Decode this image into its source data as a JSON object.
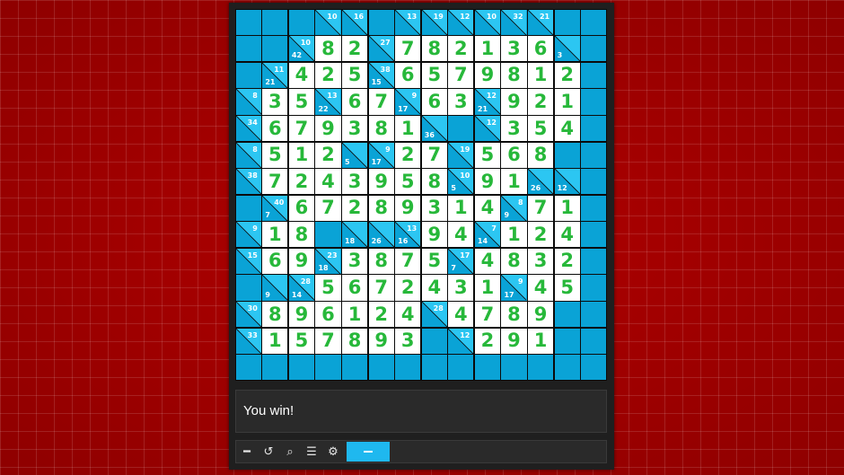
{
  "status": {
    "message": "You win!"
  },
  "toolbar": {
    "buttons": [
      {
        "name": "menu-dash-button",
        "icon": "dash-icon",
        "glyph": "━"
      },
      {
        "name": "restart-button",
        "icon": "restart-icon",
        "glyph": "↺"
      },
      {
        "name": "search-button",
        "icon": "search-icon",
        "glyph": "⌕"
      },
      {
        "name": "list-button",
        "icon": "list-icon",
        "glyph": "☰"
      },
      {
        "name": "settings-button",
        "icon": "gear-icon",
        "glyph": "⚙"
      }
    ],
    "progress": 1.0
  },
  "colors": {
    "block": "#0aa3d6",
    "block_light": "#2cc6f2",
    "digit": "#27b83a",
    "cell_bg": "#ffffff"
  },
  "grid": {
    "size": 14,
    "rows": [
      [
        "#",
        "#",
        "#",
        "c:10",
        "c:16",
        "#",
        "c:13",
        "c:19",
        "c:12",
        "c:10",
        "c:32",
        "c:21",
        "#",
        "#"
      ],
      [
        "#",
        "#",
        "c:42/10",
        "8",
        "2",
        "c:/27",
        "7",
        "8",
        "2",
        "1",
        "3",
        "6",
        "c:3/",
        "#"
      ],
      [
        "#",
        "c:21/11",
        "4",
        "2",
        "5",
        "c:15/38",
        "6",
        "5",
        "7",
        "9",
        "8",
        "1",
        "2",
        "#"
      ],
      [
        "c:/8",
        "3",
        "5",
        "c:22/13",
        "6",
        "7",
        "c:17/9",
        "6",
        "3",
        "c:21/12",
        "9",
        "2",
        "1",
        "#"
      ],
      [
        "c:/34",
        "6",
        "7",
        "9",
        "3",
        "8",
        "1",
        "c:36/",
        "#",
        "c:/12",
        "3",
        "5",
        "4",
        "#"
      ],
      [
        "c:/8",
        "5",
        "1",
        "2",
        "c:5/",
        "c:17/9",
        "2",
        "7",
        "c:/19",
        "5",
        "6",
        "8",
        "#",
        "#"
      ],
      [
        "c:/38",
        "7",
        "2",
        "4",
        "3",
        "9",
        "5",
        "8",
        "c:5/10",
        "9",
        "1",
        "c:26/",
        "c:12/",
        "#"
      ],
      [
        "#",
        "c:7/40",
        "6",
        "7",
        "2",
        "8",
        "9",
        "3",
        "1",
        "4",
        "c:9/8",
        "7",
        "1",
        "#"
      ],
      [
        "c:/9",
        "1",
        "8",
        "#",
        "c:18/",
        "c:26/",
        "c:16/13",
        "9",
        "4",
        "c:14/7",
        "1",
        "2",
        "4",
        "#"
      ],
      [
        "c:/15",
        "6",
        "9",
        "c:18/23",
        "3",
        "8",
        "7",
        "5",
        "c:7/17",
        "4",
        "8",
        "3",
        "2",
        "#"
      ],
      [
        "#",
        "c:9/",
        "c:14/28",
        "5",
        "6",
        "7",
        "2",
        "4",
        "3",
        "1",
        "c:17/9",
        "4",
        "5",
        "#"
      ],
      [
        "c:/30",
        "8",
        "9",
        "6",
        "1",
        "2",
        "4",
        "c:/28",
        "4",
        "7",
        "8",
        "9",
        "#",
        "#"
      ],
      [
        "c:/33",
        "1",
        "5",
        "7",
        "8",
        "9",
        "3",
        "#",
        "c:/12",
        "2",
        "9",
        "1",
        "#",
        "#"
      ],
      [
        "#",
        "#",
        "#",
        "#",
        "#",
        "#",
        "#",
        "#",
        "#",
        "#",
        "#",
        "#",
        "#",
        "#"
      ]
    ]
  }
}
